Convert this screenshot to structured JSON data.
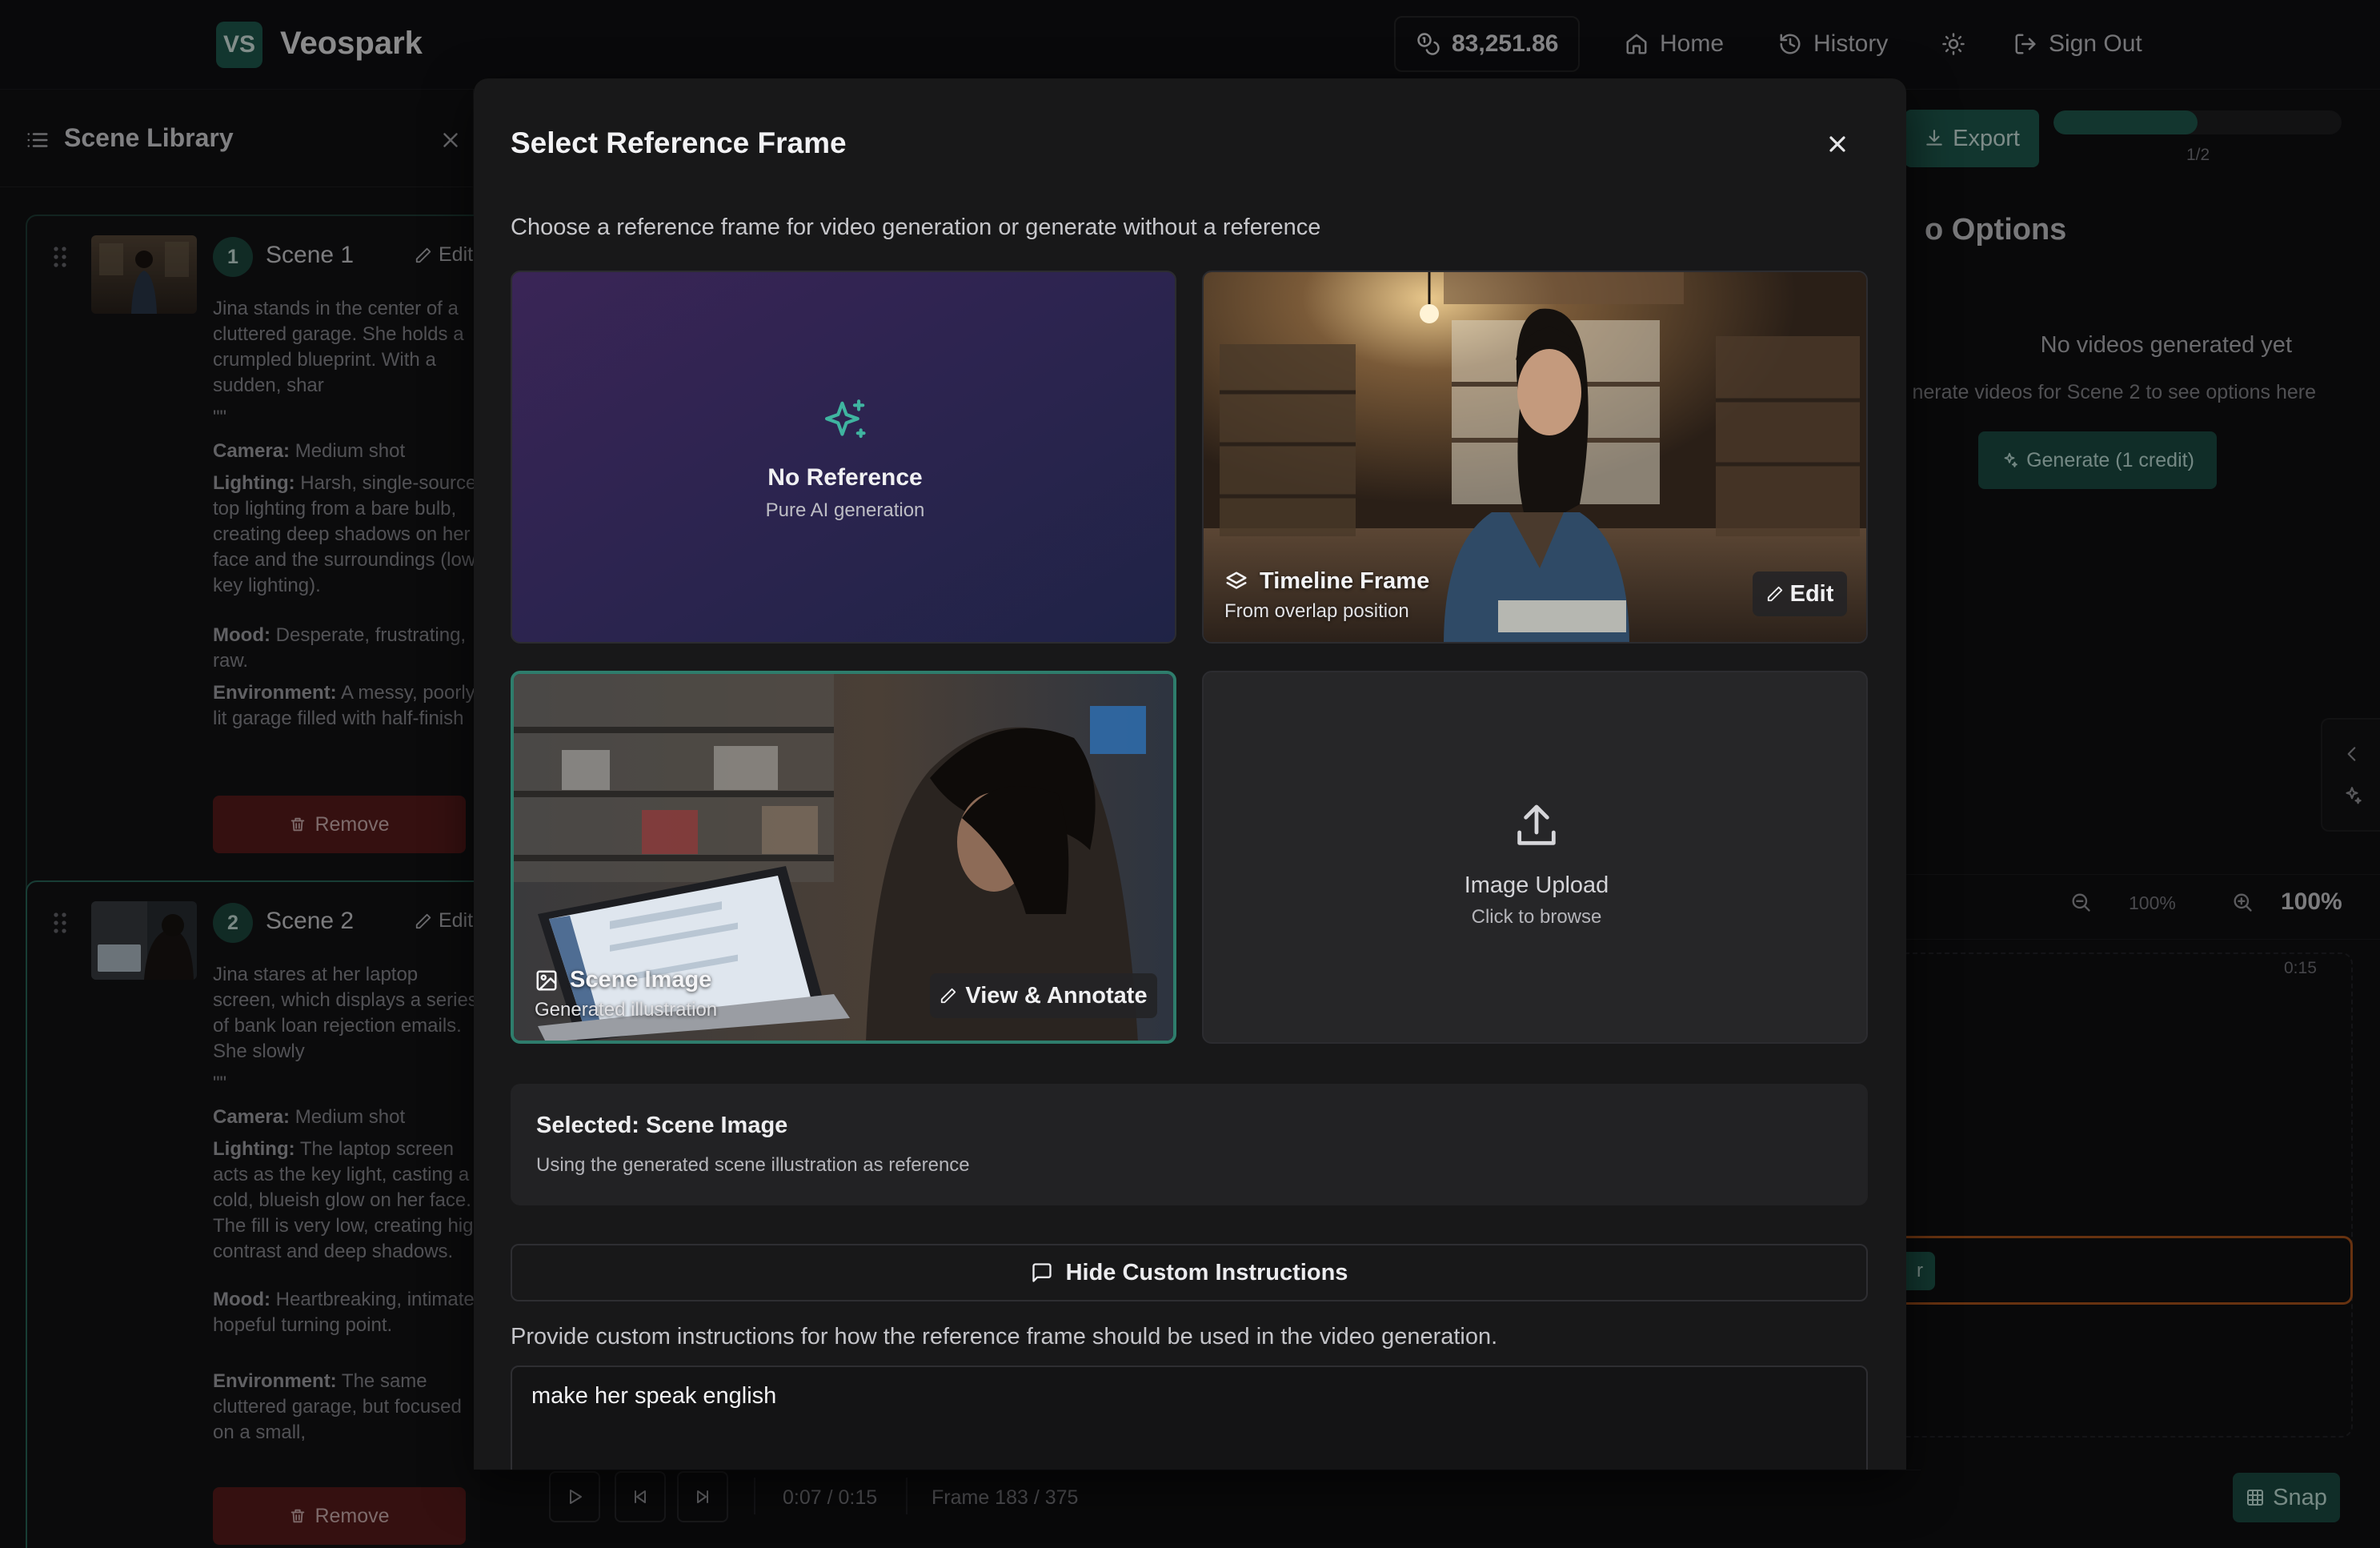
{
  "app": {
    "logo_badge": "VS",
    "name": "Veospark",
    "credits": "83,251.86",
    "nav": {
      "home": "Home",
      "history": "History",
      "sign_out": "Sign Out"
    }
  },
  "sidebar": {
    "title": "Scene Library",
    "scenes": [
      {
        "number": "1",
        "name": "Scene 1",
        "edit_label": "Edit",
        "summary": "Jina stands in the center of a cluttered garage. She holds a crumpled blueprint. With a sudden, shar",
        "quote": "\"\"",
        "camera_label": "Camera:",
        "camera": "Medium shot",
        "lighting_label": "Lighting:",
        "lighting": "Harsh, single-source top lighting from a bare bulb, creating deep shadows on her face and the surroundings (low-key lighting).",
        "mood_label": "Mood:",
        "mood": "Desperate, frustrating, raw.",
        "environment_label": "Environment:",
        "environment": "A messy, poorly-lit garage filled with half-finish",
        "remove_label": "Remove"
      },
      {
        "number": "2",
        "name": "Scene 2",
        "edit_label": "Edit",
        "summary": "Jina stares at her laptop screen, which displays a series of bank loan rejection emails. She slowly",
        "quote": "\"\"",
        "camera_label": "Camera:",
        "camera": "Medium shot",
        "lighting_label": "Lighting:",
        "lighting": "The laptop screen acts as the key light, casting a cold, blueish glow on her face. The fill is very low, creating high contrast and deep shadows.",
        "mood_label": "Mood:",
        "mood": "Heartbreaking, intimate, hopeful turning point.",
        "environment_label": "Environment:",
        "environment": "The same cluttered garage, but focused on a small,",
        "remove_label": "Remove"
      }
    ]
  },
  "right_panel": {
    "export_label": "Export",
    "progress_value": 0.5,
    "progress_label": "1/2",
    "options_title": "o Options",
    "empty_title": "No videos generated yet",
    "empty_sub": "nerate videos for Scene 2 to see options here",
    "generate_label": "Generate (1 credit)",
    "zoom_mid": "100%",
    "zoom_big": "100%",
    "ruler_end": "0:15",
    "clip_label": "r",
    "snap_label": "Snap"
  },
  "transport": {
    "time": "0:07 / 0:15",
    "frame": "Frame 183 / 375"
  },
  "modal": {
    "title": "Select Reference Frame",
    "description": "Choose a reference frame for video generation or generate without a reference",
    "options": {
      "no_reference": {
        "title": "No Reference",
        "subtitle": "Pure AI generation"
      },
      "timeline_frame": {
        "title": "Timeline Frame",
        "subtitle": "From overlap position",
        "action": "Edit"
      },
      "scene_image": {
        "title": "Scene Image",
        "subtitle": "Generated illustration",
        "action": "View & Annotate"
      },
      "image_upload": {
        "title": "Image Upload",
        "subtitle": "Click to browse"
      }
    },
    "selected_title": "Selected: Scene Image",
    "selected_sub": "Using the generated scene illustration as reference",
    "toggle_instructions": "Hide Custom Instructions",
    "instructions_desc": "Provide custom instructions for how the reference frame should be used in the video generation.",
    "instructions_value": "make her speak english"
  }
}
